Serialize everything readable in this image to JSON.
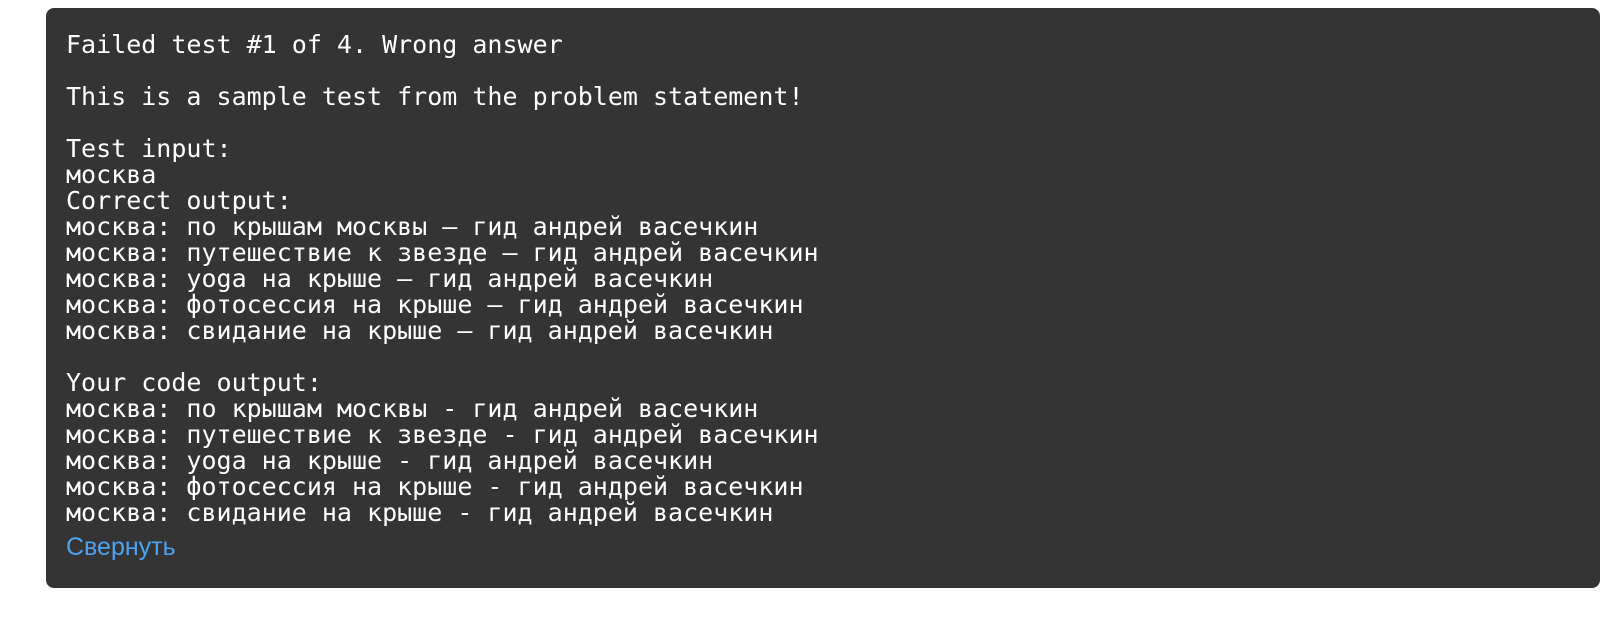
{
  "result": {
    "headline": "Failed test #1 of 4. Wrong answer",
    "note": "This is a sample test from the problem statement!",
    "test_input_label": "Test input:",
    "test_input_lines": [
      "москва"
    ],
    "correct_output_label": "Correct output:",
    "correct_output_lines": [
      "москва: по крышам москвы — гид андрей васечкин",
      "москва: путешествие к звезде — гид андрей васечкин",
      "москва: yoga на крыше — гид андрей васечкин",
      "москва: фотосессия на крыше — гид андрей васечкин",
      "москва: свидание на крыше — гид андрей васечкин"
    ],
    "your_output_label": "Your code output:",
    "your_output_lines": [
      "москва: по крышам москвы - гид андрей васечкин",
      "москва: путешествие к звезде - гид андрей васечкин",
      "москва: yoga на крыше - гид андрей васечкин",
      "москва: фотосессия на крыше - гид андрей васечкин",
      "москва: свидание на крыше - гид андрей васечкин"
    ],
    "collapse_label": "Свернуть"
  },
  "colors": {
    "panel_background": "#343434",
    "text": "#ffffff",
    "link": "#4ea3f0"
  }
}
